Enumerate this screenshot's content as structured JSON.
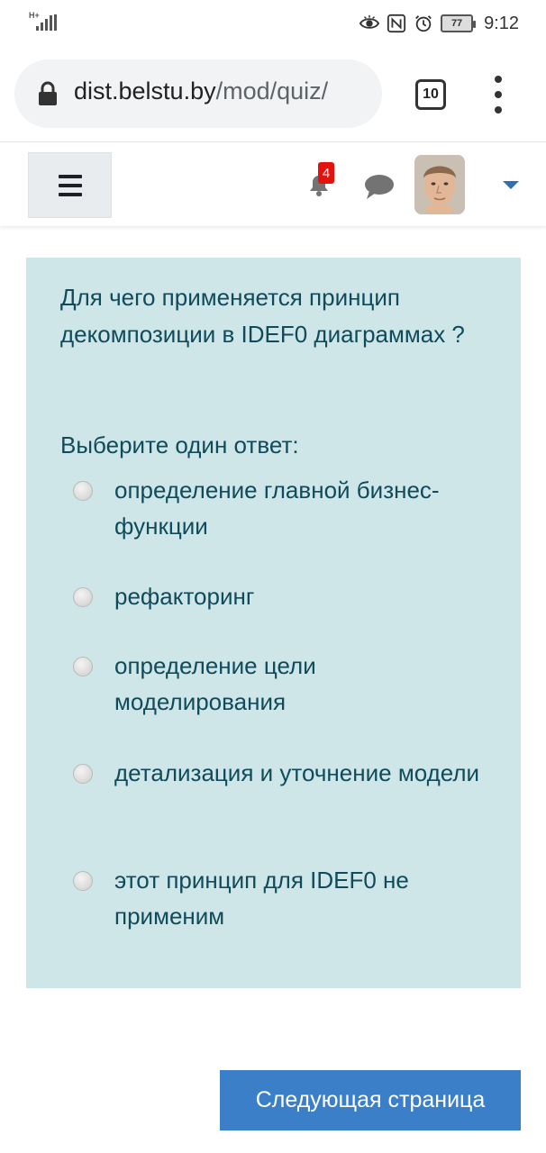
{
  "status_bar": {
    "network_label": "H+",
    "icons": [
      "eye-icon",
      "nfc-icon",
      "alarm-icon"
    ],
    "battery": "77",
    "time": "9:12"
  },
  "browser": {
    "url_host": "dist.belstu.by",
    "url_path": "/mod/quiz/",
    "tab_count": "10",
    "icons": [
      "lock-icon",
      "tabs-icon",
      "menu-icon"
    ]
  },
  "navbar": {
    "notification_count": "4",
    "icons": [
      "hamburger-icon",
      "bell-icon",
      "chat-icon",
      "avatar",
      "caret-down-icon"
    ],
    "accent_color": "#2f6fb3"
  },
  "question": {
    "text": "Для чего применяется принцип декомпозиции в IDEF0 диаграммах ?",
    "prompt": "Выберите один ответ:",
    "background_color": "#cfe6e9",
    "text_color": "#0f4b5a",
    "answers": [
      {
        "label": "определение главной бизнес-функции"
      },
      {
        "label": "рефакторинг"
      },
      {
        "label": "определение цели моделирования"
      },
      {
        "label": "детализация и уточнение модели"
      },
      {
        "label": "этот принцип для IDEF0 не применим"
      }
    ]
  },
  "actions": {
    "next_label": "Следующая страница",
    "next_color": "#3a7fc8"
  }
}
